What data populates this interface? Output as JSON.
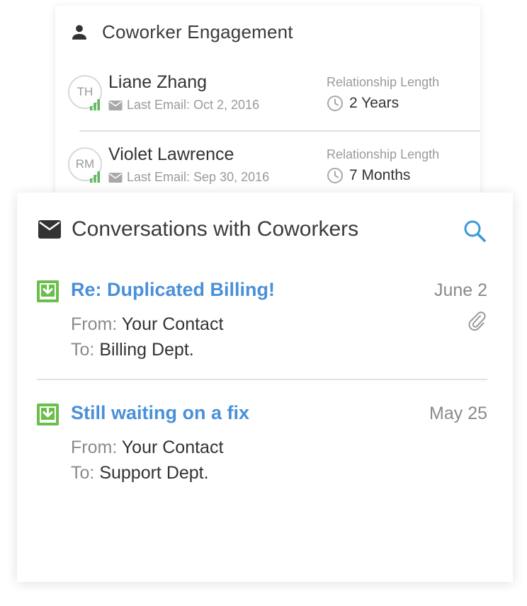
{
  "engagement": {
    "title": "Coworker Engagement",
    "header_icon": "person-icon",
    "coworkers": [
      {
        "initials": "TH",
        "name": "Liane Zhang",
        "last_email": "Last Email: Oct 2, 2016",
        "relationship_label": "Relationship Length",
        "relationship_value": "2 Years"
      },
      {
        "initials": "RM",
        "name": "Violet Lawrence",
        "last_email": "Last Email: Sep 30, 2016",
        "relationship_label": "Relationship Length",
        "relationship_value": "7 Months"
      }
    ]
  },
  "conversations": {
    "title": "Conversations with Coworkers",
    "header_icon": "envelope-icon",
    "search_icon": "search-icon",
    "items": [
      {
        "subject": "Re: Duplicated Billing!",
        "date": "June 2",
        "from_label": "From:",
        "from_value": "Your Contact",
        "to_label": "To:",
        "to_value": "Billing Dept.",
        "has_attachment": true
      },
      {
        "subject": "Still waiting on a fix",
        "date": "May 25",
        "from_label": "From:",
        "from_value": "Your Contact",
        "to_label": "To:",
        "to_value": "Support Dept.",
        "has_attachment": false
      }
    ]
  },
  "colors": {
    "accent_blue": "#4a90d9",
    "inbox_green": "#6abf4b",
    "signal_green": "#5cb85c",
    "text_dark": "#333333",
    "text_muted": "#9a9a9a"
  }
}
